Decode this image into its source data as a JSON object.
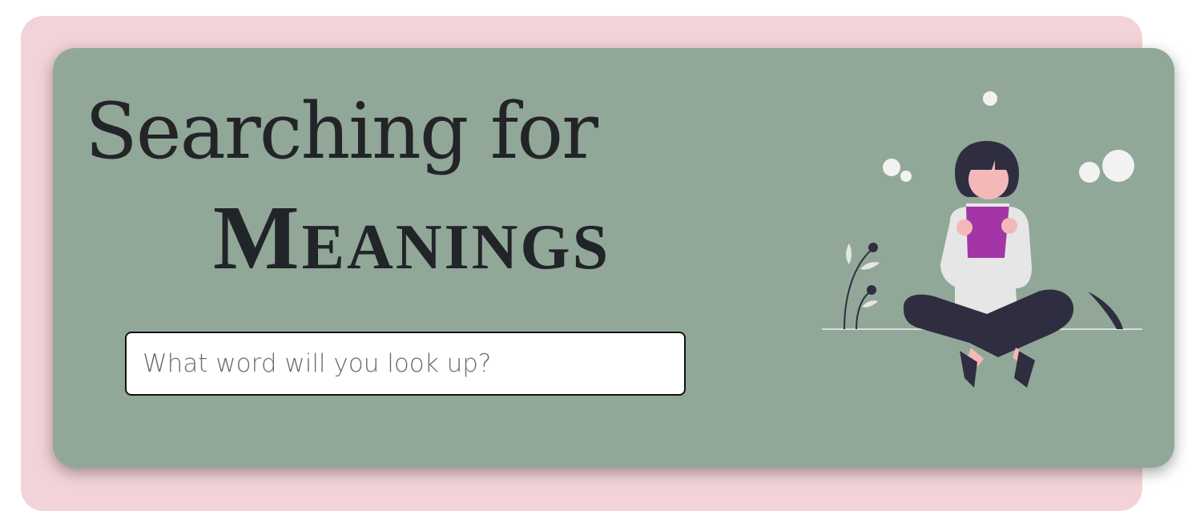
{
  "hero": {
    "title_line1": "Searching for",
    "title_line2": "Meanings"
  },
  "search": {
    "placeholder": "What word will you look up?",
    "value": ""
  },
  "illustration": {
    "name": "woman-reading-book",
    "colors": {
      "card": "#91a898",
      "panel": "#f2d3d7",
      "book": "#a435a6",
      "hair": "#2f2e41",
      "skin": "#f5b8b8",
      "shirt": "#e6e6e6",
      "bubbles": "#f2f2f2"
    }
  }
}
